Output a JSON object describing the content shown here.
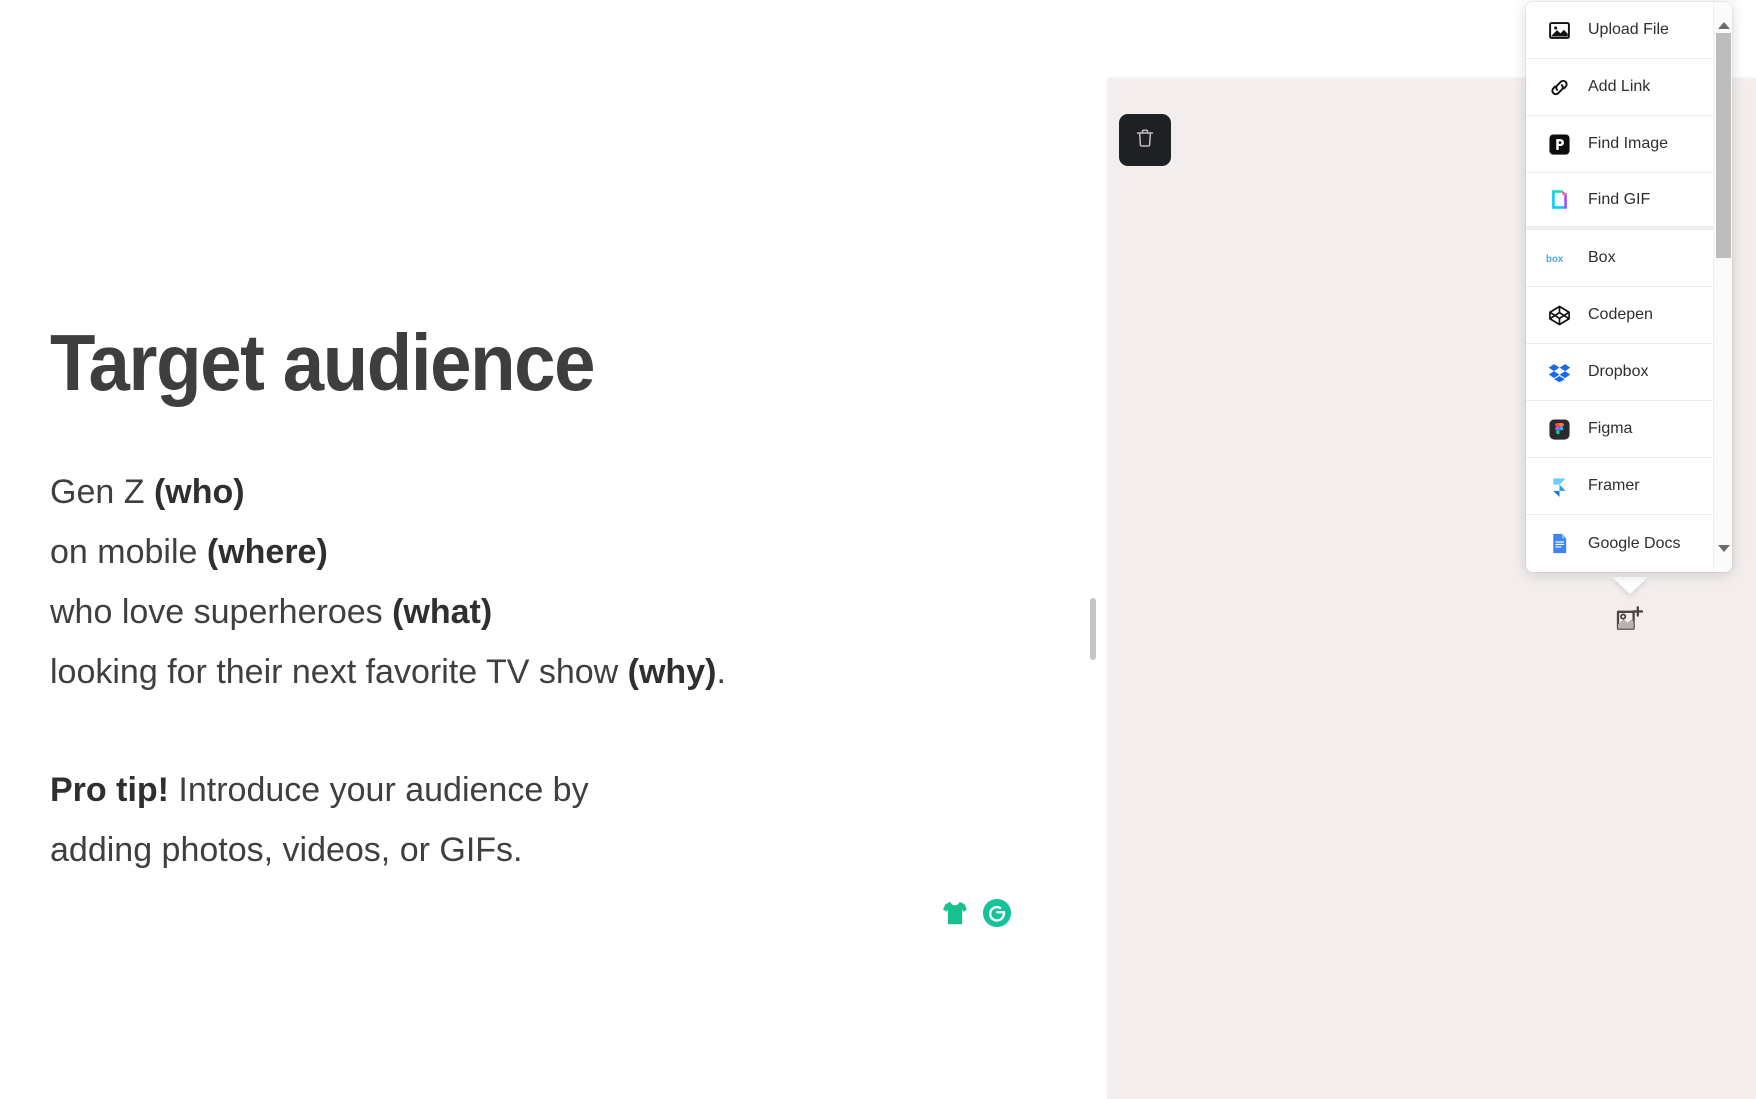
{
  "slide": {
    "title": "Target audience",
    "body_lines": [
      {
        "normal": "Gen Z ",
        "bold": "(who)",
        "tail": ""
      },
      {
        "normal": "on mobile ",
        "bold": "(where)",
        "tail": ""
      },
      {
        "normal": "who love superheroes ",
        "bold": "(what)",
        "tail": ""
      },
      {
        "normal": "looking for their next favorite TV show ",
        "bold": "(why)",
        "tail": "."
      }
    ],
    "pro_tip": {
      "bold": "Pro tip!",
      "line1": " Introduce your audience by",
      "line2": "adding photos, videos, or GIFs."
    }
  },
  "green_icons": [
    {
      "name": "tshirt-icon",
      "label": "T-shirt",
      "color": "#18bf8f"
    },
    {
      "name": "grammarly-icon",
      "label": "Grammarly",
      "color": "#15c39a"
    }
  ],
  "panel": {
    "background_color": "#f3eeed",
    "delete_label": "Delete",
    "add_image_label": "Add image"
  },
  "insert_menu": {
    "items": [
      {
        "label": "Upload File",
        "icon": "image-upload-icon",
        "group_end": false
      },
      {
        "label": "Add Link",
        "icon": "link-icon",
        "group_end": false
      },
      {
        "label": "Find Image",
        "icon": "pexels-icon",
        "group_end": false
      },
      {
        "label": "Find GIF",
        "icon": "giphy-icon",
        "group_end": true
      },
      {
        "label": "Box",
        "icon": "box-icon",
        "group_end": false
      },
      {
        "label": "Codepen",
        "icon": "codepen-icon",
        "group_end": false
      },
      {
        "label": "Dropbox",
        "icon": "dropbox-icon",
        "group_end": false
      },
      {
        "label": "Figma",
        "icon": "figma-icon",
        "group_end": false
      },
      {
        "label": "Framer",
        "icon": "framer-icon",
        "group_end": false
      },
      {
        "label": "Google Docs",
        "icon": "google-docs-icon",
        "group_end": false
      }
    ],
    "scroll_up_label": "Scroll up",
    "scroll_down_label": "Scroll down"
  },
  "colors": {
    "title_text": "#3e3e3e",
    "body_text": "#3f3f3f",
    "menu_text": "#2e2e2e",
    "panel_bg": "#f3eeed",
    "delete_bg": "#1e2024",
    "accent_green": "#15c39a"
  }
}
